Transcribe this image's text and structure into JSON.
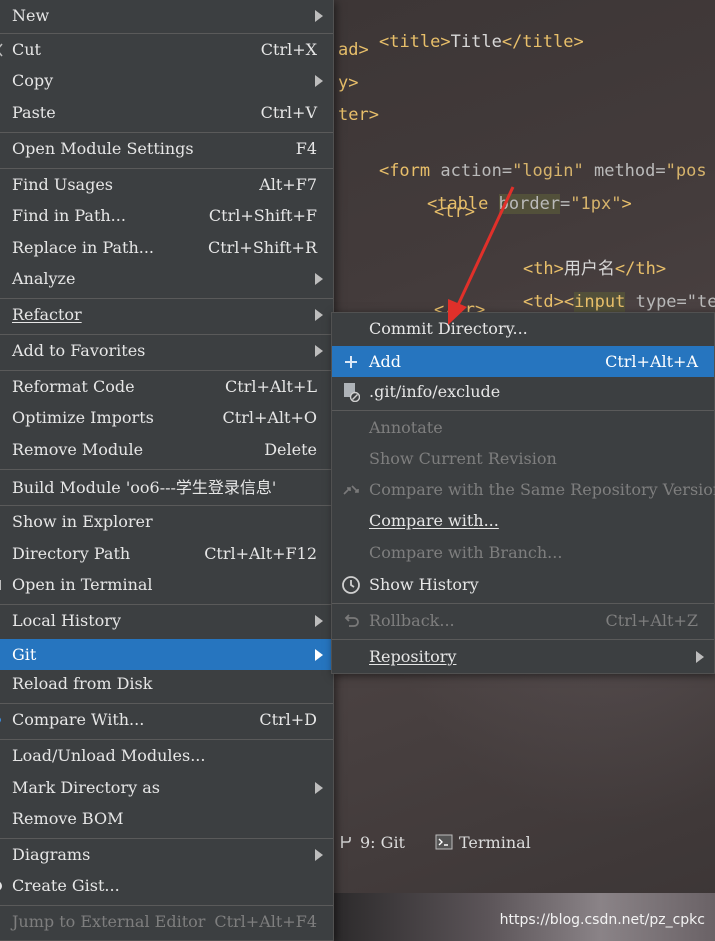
{
  "editor": {
    "lines": [
      {
        "prefix": "<",
        "tag": "title",
        "text": "Title",
        "close": "</title>"
      },
      {
        "tail": "ad>"
      },
      {
        "tail": "y>"
      },
      {
        "tail": "ter>"
      },
      {
        "form_open": "<form",
        "attr1": "action",
        "val1": "\"login\"",
        "attr2": "method",
        "val2": "\"pos"
      },
      {
        "table_open": "<table",
        "attr": "border",
        "eq": "=",
        "val": "\"1px\"",
        "end": ">"
      },
      {
        "tr": "<tr>"
      },
      {
        "th_open": "<th>",
        "th_text": "用户名",
        "th_close": "</th>"
      },
      {
        "td_open": "<td>",
        "input_lt": "<",
        "input": "input",
        "type": "type=\"tex"
      },
      {
        "tr_close": "</tr>"
      }
    ]
  },
  "main_menu": {
    "items": [
      {
        "label": "New",
        "shortcut": "",
        "arrow": true
      },
      {
        "label": "Cut",
        "shortcut": "Ctrl+X"
      },
      {
        "label": "Copy",
        "shortcut": "",
        "arrow": true
      },
      {
        "label": "Paste",
        "shortcut": "Ctrl+V"
      },
      {
        "label": "Open Module Settings",
        "shortcut": "F4"
      },
      {
        "label": "Find Usages",
        "shortcut": "Alt+F7"
      },
      {
        "label": "Find in Path...",
        "shortcut": "Ctrl+Shift+F"
      },
      {
        "label": "Replace in Path...",
        "shortcut": "Ctrl+Shift+R"
      },
      {
        "label": "Analyze",
        "shortcut": "",
        "arrow": true
      },
      {
        "label": "Refactor",
        "shortcut": "",
        "arrow": true
      },
      {
        "label": "Add to Favorites",
        "shortcut": "",
        "arrow": true
      },
      {
        "label": "Reformat Code",
        "shortcut": "Ctrl+Alt+L"
      },
      {
        "label": "Optimize Imports",
        "shortcut": "Ctrl+Alt+O"
      },
      {
        "label": "Remove Module",
        "shortcut": "Delete"
      },
      {
        "label": "Build Module 'oo6---学生登录信息'",
        "shortcut": ""
      },
      {
        "label": "Show in Explorer",
        "shortcut": ""
      },
      {
        "label": "Directory Path",
        "shortcut": "Ctrl+Alt+F12"
      },
      {
        "label": "Open in Terminal",
        "shortcut": ""
      },
      {
        "label": "Local History",
        "shortcut": "",
        "arrow": true
      },
      {
        "label": "Git",
        "shortcut": "",
        "arrow": true
      },
      {
        "label": "Reload from Disk",
        "shortcut": ""
      },
      {
        "label": "Compare With...",
        "shortcut": "Ctrl+D"
      },
      {
        "label": "Load/Unload Modules...",
        "shortcut": ""
      },
      {
        "label": "Mark Directory as",
        "shortcut": "",
        "arrow": true
      },
      {
        "label": "Remove BOM",
        "shortcut": ""
      },
      {
        "label": "Diagrams",
        "shortcut": "",
        "arrow": true
      },
      {
        "label": "Create Gist...",
        "shortcut": ""
      },
      {
        "label": "Jump to External Editor",
        "shortcut": "Ctrl+Alt+F4"
      }
    ]
  },
  "git_submenu": {
    "items": [
      {
        "label": "Commit Directory...",
        "shortcut": ""
      },
      {
        "label": "Add",
        "shortcut": "Ctrl+Alt+A",
        "icon": "plus-icon"
      },
      {
        "label": ".git/info/exclude",
        "shortcut": "",
        "icon": "file-exclude-icon"
      },
      {
        "label": "Annotate",
        "shortcut": ""
      },
      {
        "label": "Show Current Revision",
        "shortcut": ""
      },
      {
        "label": "Compare with the Same Repository Version",
        "shortcut": "",
        "icon": "compare-arrows-icon"
      },
      {
        "label": "Compare with...",
        "shortcut": ""
      },
      {
        "label": "Compare with Branch...",
        "shortcut": ""
      },
      {
        "label": "Show History",
        "shortcut": "",
        "icon": "clock-icon"
      },
      {
        "label": "Rollback...",
        "shortcut": "Ctrl+Alt+Z",
        "icon": "undo-icon"
      },
      {
        "label": "Repository",
        "shortcut": "",
        "arrow": true
      }
    ]
  },
  "tool_strip": {
    "git_label": "9: Git",
    "terminal_label": "Terminal"
  },
  "watermark": "https://blog.csdn.net/pz_cpkc",
  "colors": {
    "menu_bg": "#3c3f41",
    "selection": "#2675bf",
    "annotation_arrow": "#e0302a"
  }
}
